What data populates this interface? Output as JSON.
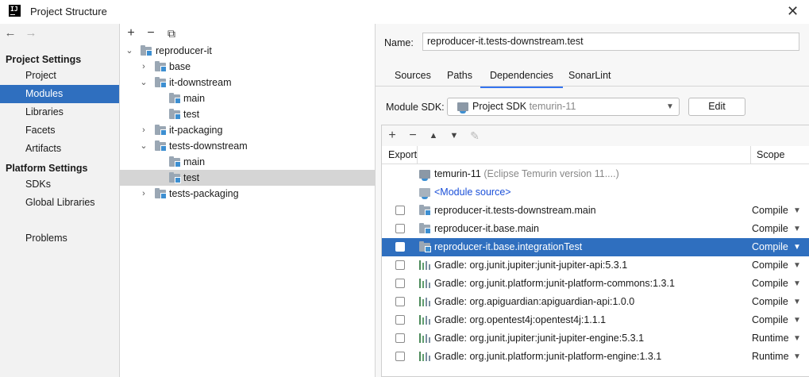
{
  "window": {
    "title": "Project Structure",
    "logo_text": "IJ",
    "close_glyph": "✕"
  },
  "nav": {
    "back_glyph": "←",
    "forward_glyph": "→",
    "project_settings_header": "Project Settings",
    "project_settings_items": [
      "Project",
      "Modules",
      "Libraries",
      "Facets",
      "Artifacts"
    ],
    "selected_item": "Modules",
    "platform_settings_header": "Platform Settings",
    "platform_settings_items": [
      "SDKs",
      "Global Libraries"
    ],
    "problems": "Problems"
  },
  "tree": {
    "toolbar": {
      "add": "+",
      "remove": "−",
      "copy": "⧉"
    },
    "nodes": [
      {
        "label": "reproducer-it",
        "chevron": "⌄"
      },
      {
        "label": "base",
        "chevron": "›"
      },
      {
        "label": "it-downstream",
        "chevron": "⌄"
      },
      {
        "label": "main",
        "chevron": ""
      },
      {
        "label": "test",
        "chevron": ""
      },
      {
        "label": "it-packaging",
        "chevron": "›"
      },
      {
        "label": "tests-downstream",
        "chevron": "⌄"
      },
      {
        "label": "main",
        "chevron": ""
      },
      {
        "label": "test",
        "chevron": ""
      },
      {
        "label": "tests-packaging",
        "chevron": "›"
      }
    ],
    "selected_index": 8
  },
  "module": {
    "name_label": "Name:",
    "name_value": "reproducer-it.tests-downstream.test",
    "tabs": [
      "Sources",
      "Paths",
      "Dependencies",
      "SonarLint"
    ],
    "active_tab": "Dependencies",
    "sdk_label": "Module SDK:",
    "sdk_value": "Project SDK",
    "sdk_detail": "temurin-11",
    "sdk_arrow": "▼",
    "edit_button": "Edit"
  },
  "dependencies": {
    "toolbar": {
      "add": "+",
      "remove": "−",
      "up": "▲",
      "down": "▼",
      "edit": "✎"
    },
    "header_export": "Export",
    "header_scope": "Scope",
    "scope_arrow": "▼",
    "rows": [
      {
        "icon": "sdk-icon",
        "name": "temurin-11",
        "detail": "(Eclipse Temurin version 11....)",
        "scope": "",
        "checkbox": false,
        "link": false
      },
      {
        "icon": "folder-icon",
        "name": "<Module source>",
        "detail": "",
        "scope": "",
        "checkbox": false,
        "link": true
      },
      {
        "icon": "module-folder-icon",
        "name": "reproducer-it.tests-downstream.main",
        "detail": "",
        "scope": "Compile",
        "checkbox": true,
        "link": false
      },
      {
        "icon": "module-folder-icon",
        "name": "reproducer-it.base.main",
        "detail": "",
        "scope": "Compile",
        "checkbox": true,
        "link": false
      },
      {
        "icon": "module-folder-icon",
        "name": "reproducer-it.base.integrationTest",
        "detail": "",
        "scope": "Compile",
        "checkbox": true,
        "link": false
      },
      {
        "icon": "gradle-library-icon",
        "name": "Gradle: org.junit.jupiter:junit-jupiter-api:5.3.1",
        "detail": "",
        "scope": "Compile",
        "checkbox": true,
        "link": false
      },
      {
        "icon": "gradle-library-icon",
        "name": "Gradle: org.junit.platform:junit-platform-commons:1.3.1",
        "detail": "",
        "scope": "Compile",
        "checkbox": true,
        "link": false
      },
      {
        "icon": "gradle-library-icon",
        "name": "Gradle: org.apiguardian:apiguardian-api:1.0.0",
        "detail": "",
        "scope": "Compile",
        "checkbox": true,
        "link": false
      },
      {
        "icon": "gradle-library-icon",
        "name": "Gradle: org.opentest4j:opentest4j:1.1.1",
        "detail": "",
        "scope": "Compile",
        "checkbox": true,
        "link": false
      },
      {
        "icon": "gradle-library-icon",
        "name": "Gradle: org.junit.jupiter:junit-jupiter-engine:5.3.1",
        "detail": "",
        "scope": "Runtime",
        "checkbox": true,
        "link": false
      },
      {
        "icon": "gradle-library-icon",
        "name": "Gradle: org.junit.platform:junit-platform-engine:1.3.1",
        "detail": "",
        "scope": "Runtime",
        "checkbox": true,
        "link": false
      }
    ],
    "selected_index": 4
  },
  "colors": {
    "selection": "#2f6fbf",
    "tree_selection": "#d5d5d5",
    "tab_underline": "#3574f0",
    "link": "#1a4fd8"
  }
}
